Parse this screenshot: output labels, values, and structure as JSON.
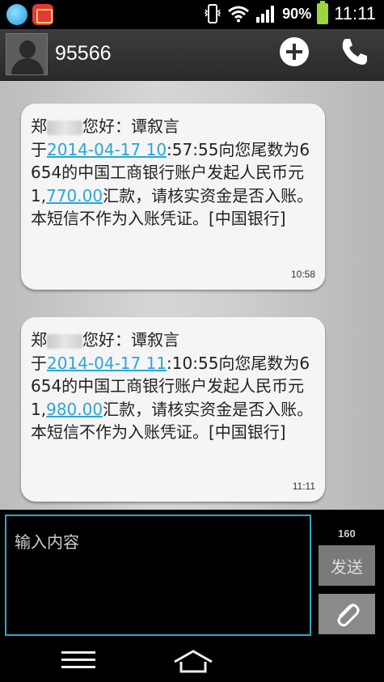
{
  "status_bar": {
    "icons": [
      "qq-icon",
      "gift-icon",
      "vibrate-icon",
      "wifi-icon",
      "signal-icon",
      "battery-icon"
    ],
    "battery_percent": "90%",
    "clock": "11:11"
  },
  "header": {
    "contact": "95566",
    "add_icon": "plus-icon",
    "call_icon": "phone-icon"
  },
  "messages": [
    {
      "greeting_start": "郑",
      "greeting_end": "您好：谭叙言",
      "yu": "于",
      "link_date": "2014-04-17 10",
      "after_link": ":57:55向您尾数为6654的中国工商银行账户发起人民币元 1,",
      "amount_link": "770.00",
      "tail": "汇款，请核实资金是否入账。本短信不作为入账凭证。[中国银行]",
      "time": "10:58"
    },
    {
      "greeting_start": "郑",
      "greeting_end": "您好：谭叙言",
      "yu": "于",
      "link_date": "2014-04-17 11",
      "after_link": ":10:55向您尾数为6654的中国工商银行账户发起人民币元 1,",
      "amount_link": "980.00",
      "tail": "汇款，请核实资金是否入账。本短信不作为入账凭证。[中国银行]",
      "time": "11:11"
    }
  ],
  "compose": {
    "placeholder": "输入内容",
    "char_count": "160",
    "send_label": "发送",
    "attach_icon": "paperclip-icon"
  },
  "nav": {
    "menu_icon": "menu-icon",
    "home_icon": "home-icon"
  },
  "colors": {
    "link": "#2ba6d9",
    "input_border": "#2aa6cc",
    "battery": "#9bd63b"
  }
}
